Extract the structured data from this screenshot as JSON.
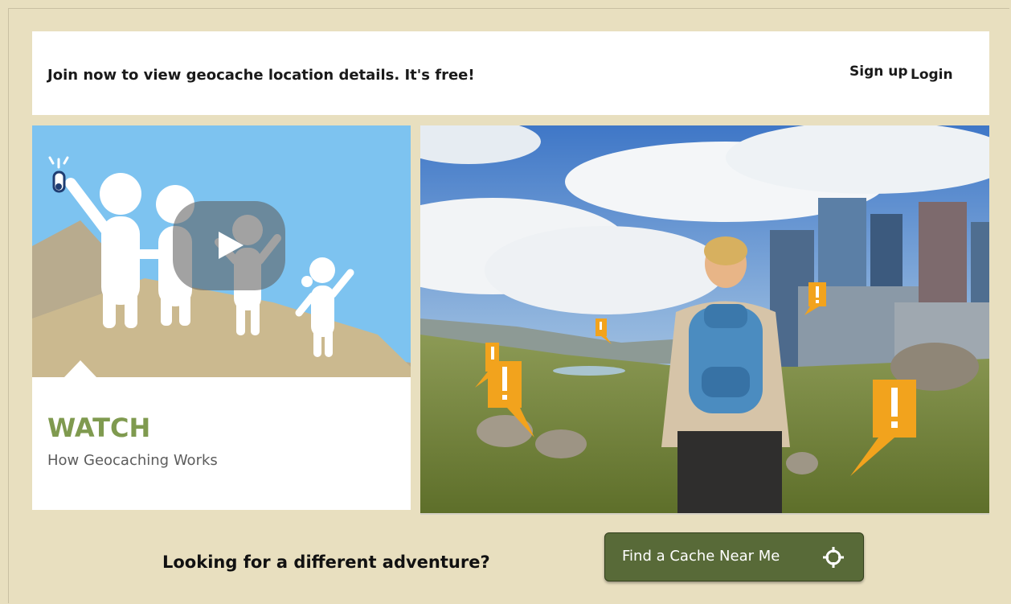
{
  "banner": {
    "text": "Join now to view geocache location details. It's free!",
    "signup_label": "Sign up",
    "login_label": "Login"
  },
  "watch": {
    "title": "WATCH",
    "subtitle": "How Geocaching Works"
  },
  "footer": {
    "question": "Looking for a different adventure?",
    "button_label": "Find a Cache Near Me",
    "button_icon": "crosshair-icon"
  },
  "colors": {
    "page_bg": "#e8dfbf",
    "accent_green": "#7f9a4f",
    "button_green": "#586a38",
    "marker_orange": "#f2a31d"
  }
}
